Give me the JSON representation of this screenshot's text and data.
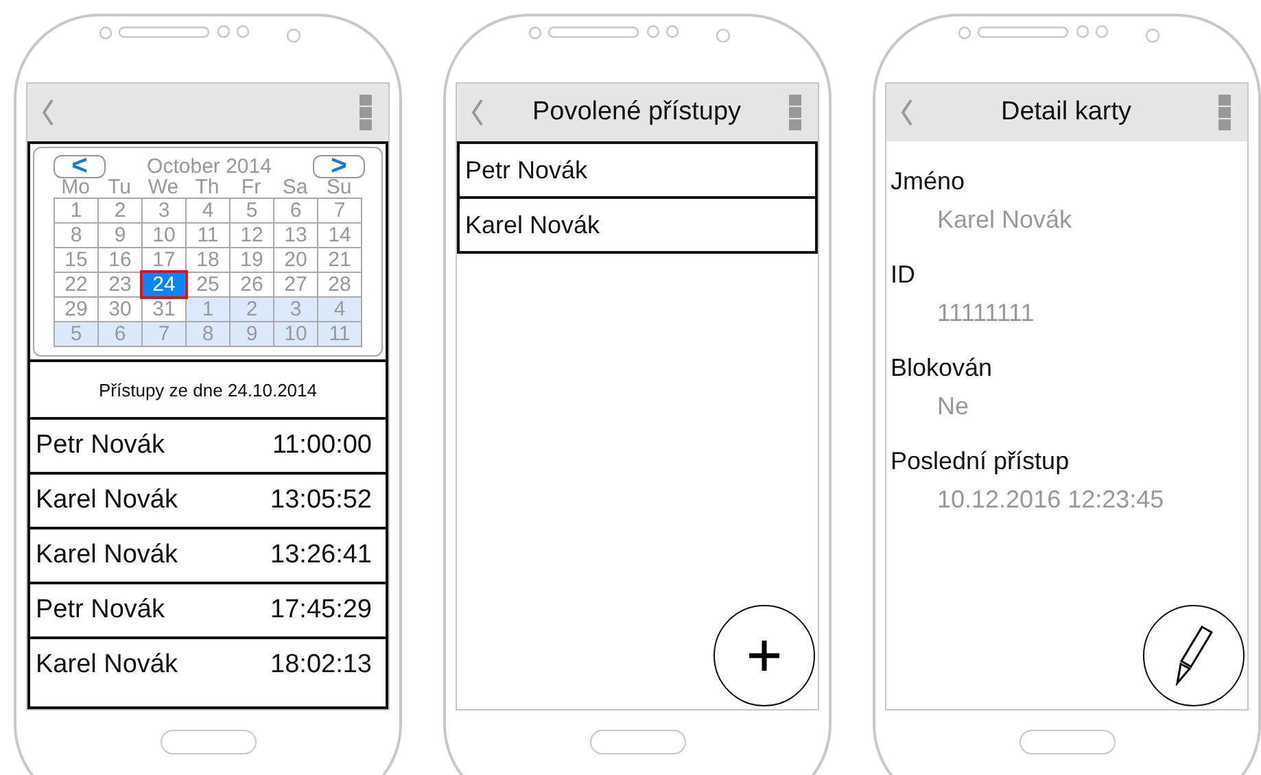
{
  "screens": [
    {
      "kind": "access_log",
      "calendar": {
        "prev": "<",
        "next": ">",
        "month": "October 2014",
        "weekdays": [
          "Mo",
          "Tu",
          "We",
          "Th",
          "Fr",
          "Sa",
          "Su"
        ],
        "days": [
          {
            "label": "1",
            "outside": false,
            "selected": false
          },
          {
            "label": "2",
            "outside": false,
            "selected": false
          },
          {
            "label": "3",
            "outside": false,
            "selected": false
          },
          {
            "label": "4",
            "outside": false,
            "selected": false
          },
          {
            "label": "5",
            "outside": false,
            "selected": false
          },
          {
            "label": "6",
            "outside": false,
            "selected": false
          },
          {
            "label": "7",
            "outside": false,
            "selected": false
          },
          {
            "label": "8",
            "outside": false,
            "selected": false
          },
          {
            "label": "9",
            "outside": false,
            "selected": false
          },
          {
            "label": "10",
            "outside": false,
            "selected": false
          },
          {
            "label": "11",
            "outside": false,
            "selected": false
          },
          {
            "label": "12",
            "outside": false,
            "selected": false
          },
          {
            "label": "13",
            "outside": false,
            "selected": false
          },
          {
            "label": "14",
            "outside": false,
            "selected": false
          },
          {
            "label": "15",
            "outside": false,
            "selected": false
          },
          {
            "label": "16",
            "outside": false,
            "selected": false
          },
          {
            "label": "17",
            "outside": false,
            "selected": false
          },
          {
            "label": "18",
            "outside": false,
            "selected": false
          },
          {
            "label": "19",
            "outside": false,
            "selected": false
          },
          {
            "label": "20",
            "outside": false,
            "selected": false
          },
          {
            "label": "21",
            "outside": false,
            "selected": false
          },
          {
            "label": "22",
            "outside": false,
            "selected": false
          },
          {
            "label": "23",
            "outside": false,
            "selected": false
          },
          {
            "label": "24",
            "outside": false,
            "selected": true
          },
          {
            "label": "25",
            "outside": false,
            "selected": false
          },
          {
            "label": "26",
            "outside": false,
            "selected": false
          },
          {
            "label": "27",
            "outside": false,
            "selected": false
          },
          {
            "label": "28",
            "outside": false,
            "selected": false
          },
          {
            "label": "29",
            "outside": false,
            "selected": false
          },
          {
            "label": "30",
            "outside": false,
            "selected": false
          },
          {
            "label": "31",
            "outside": false,
            "selected": false
          },
          {
            "label": "1",
            "outside": true,
            "selected": false
          },
          {
            "label": "2",
            "outside": true,
            "selected": false
          },
          {
            "label": "3",
            "outside": true,
            "selected": false
          },
          {
            "label": "4",
            "outside": true,
            "selected": false
          },
          {
            "label": "5",
            "outside": true,
            "selected": false
          },
          {
            "label": "6",
            "outside": true,
            "selected": false
          },
          {
            "label": "7",
            "outside": true,
            "selected": false
          },
          {
            "label": "8",
            "outside": true,
            "selected": false
          },
          {
            "label": "9",
            "outside": true,
            "selected": false
          },
          {
            "label": "10",
            "outside": true,
            "selected": false
          },
          {
            "label": "11",
            "outside": true,
            "selected": false
          }
        ]
      },
      "list_title": "Přístupy ze dne 24.10.2014",
      "entries": [
        {
          "name": "Petr Novák",
          "time": "11:00:00"
        },
        {
          "name": "Karel Novák",
          "time": "13:05:52"
        },
        {
          "name": "Karel Novák",
          "time": "13:26:41"
        },
        {
          "name": "Petr Novák",
          "time": "17:45:29"
        },
        {
          "name": "Karel Novák",
          "time": "18:02:13"
        }
      ]
    },
    {
      "kind": "allowed_list",
      "title": "Povolené přístupy",
      "items": [
        "Petr Novák",
        "Karel Novák"
      ]
    },
    {
      "kind": "card_detail",
      "title": "Detail karty",
      "fields": [
        {
          "label": "Jméno",
          "value": "Karel Novák"
        },
        {
          "label": "ID",
          "value": "11111111"
        },
        {
          "label": "Blokován",
          "value": "Ne"
        },
        {
          "label": "Poslední přístup",
          "value": "10.12.2016 12:23:45"
        }
      ]
    }
  ]
}
